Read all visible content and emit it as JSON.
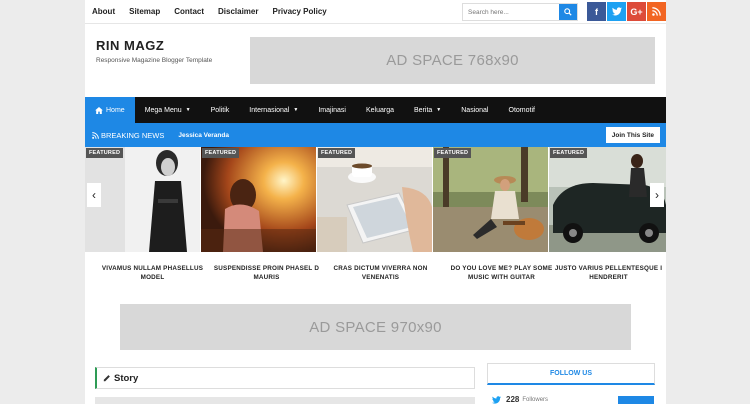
{
  "topnav": {
    "links": [
      "About",
      "Sitemap",
      "Contact",
      "Disclaimer",
      "Privacy Policy"
    ]
  },
  "search": {
    "placeholder": "Search here..."
  },
  "social": {
    "facebook": "f",
    "twitter": "t",
    "googleplus": "G+",
    "rss": "rss"
  },
  "header": {
    "title": "RIN MAGZ",
    "subtitle": "Responsive Magazine Blogger Template",
    "ad_top": "AD SPACE 768x90"
  },
  "mainnav": {
    "items": [
      "Home",
      "Mega Menu",
      "Politik",
      "Internasional",
      "Imajinasi",
      "Keluarga",
      "Berita",
      "Nasional",
      "Otomotif"
    ]
  },
  "breaking": {
    "label": "BREAKING NEWS",
    "headline": "Jessica Veranda",
    "join": "Join This Site"
  },
  "slider": {
    "badge": "FEATURED",
    "captions": [
      "VIVAMUS NULLAM PHASELLUS MODEL",
      "SUSPENDISSE PROIN PHASEL D MAURIS",
      "CRAS DICTUM VIVERRA NON VENENATIS",
      "DO YOU LOVE ME? PLAY SOME MUSIC WITH GUITAR",
      "JUSTO VARIUS PELLENTESQUE I HENDRERIT"
    ]
  },
  "ad_mid": "AD SPACE 970x90",
  "story": {
    "label": "Story"
  },
  "follow": {
    "title": "FOLLOW US",
    "count": "228",
    "followers_label": "Followers"
  },
  "colors": {
    "accent": "#1e88e5",
    "nav_bg": "#111111",
    "facebook": "#3b5998",
    "twitter": "#1da1f2",
    "googleplus": "#dd4b39",
    "rss": "#f26522",
    "story_accent": "#2e9c55"
  }
}
